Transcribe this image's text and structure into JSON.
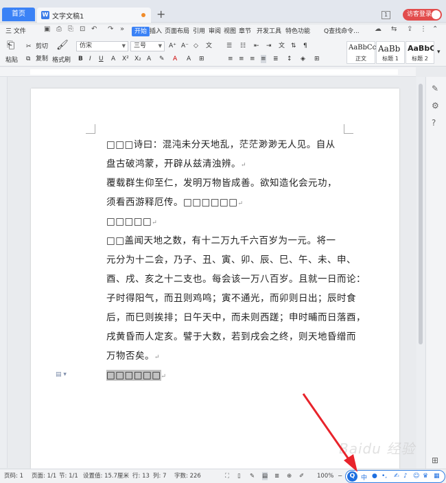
{
  "tabs": {
    "home": "首页",
    "doc_title": "文字文稿1",
    "add": "+",
    "count_badge": "1",
    "visitor": "访客登录"
  },
  "menu": {
    "file": "三 文件",
    "items": [
      "开始",
      "插入",
      "页面布局",
      "引用",
      "审阅",
      "视图",
      "章节",
      "开发工具",
      "特色功能"
    ],
    "search": "Q查找命令..."
  },
  "ribbon": {
    "paste": "粘贴",
    "cut": "剪切",
    "copy": "复制",
    "format_painter": "格式刷",
    "font_name": "仿宋",
    "font_size": "三号",
    "styles": [
      {
        "preview": "AaBbCcI",
        "name": "正文"
      },
      {
        "preview": "AaBb",
        "name": "标题 1"
      },
      {
        "preview": "AaBbC",
        "name": "标题 2"
      }
    ]
  },
  "document": {
    "paragraphs": [
      {
        "lines": [
          "□□□诗曰：混沌未分天地乱，茫茫渺渺无人见。自从",
          "盘古破鸿蒙，开辟从兹清浊辨。"
        ],
        "ret": "↵"
      },
      {
        "lines": [
          "覆载群生仰至仁，发明万物皆成善。欲知造化会元功，",
          "须看西游释厄传。□□□□□□"
        ],
        "ret": "↵"
      },
      {
        "lines": [
          "□□□□□"
        ],
        "ret": "↵"
      },
      {
        "lines": [
          "□□盖闻天地之数，有十二万九千六百岁为一元。将一",
          "元分为十二会，乃子、丑、寅、卯、辰、巳、午、未、申、",
          "酉、戌、亥之十二支也。每会该一万八百岁。且就一日而论：",
          "子时得阳气，而丑则鸡鸣；寅不通光，而卯则日出；辰时食",
          "后，而巳则挨排；日午天中，而未则西蹉；申时晡而日落酉，",
          "戌黄昏而人定亥。譬于大数，若到戌会之终，则天地昏缯而",
          "万物否矣。"
        ],
        "ret": "↵"
      },
      {
        "lines": [
          "□□□□□□"
        ],
        "ret": "↵"
      }
    ]
  },
  "status": {
    "page": "页码: 1",
    "pages": "页面: 1/1",
    "section": "节: 1/1",
    "position": "设置值: 15.7厘米",
    "row": "行: 13",
    "col": "列: 7",
    "words": "字数: 226",
    "zoom": "100%",
    "ime_lang": "中"
  },
  "watermark": "Baidu 经验",
  "colors": {
    "accent": "#3b82f6",
    "arrow": "#e8232b",
    "visitor": "#e24c4c"
  }
}
